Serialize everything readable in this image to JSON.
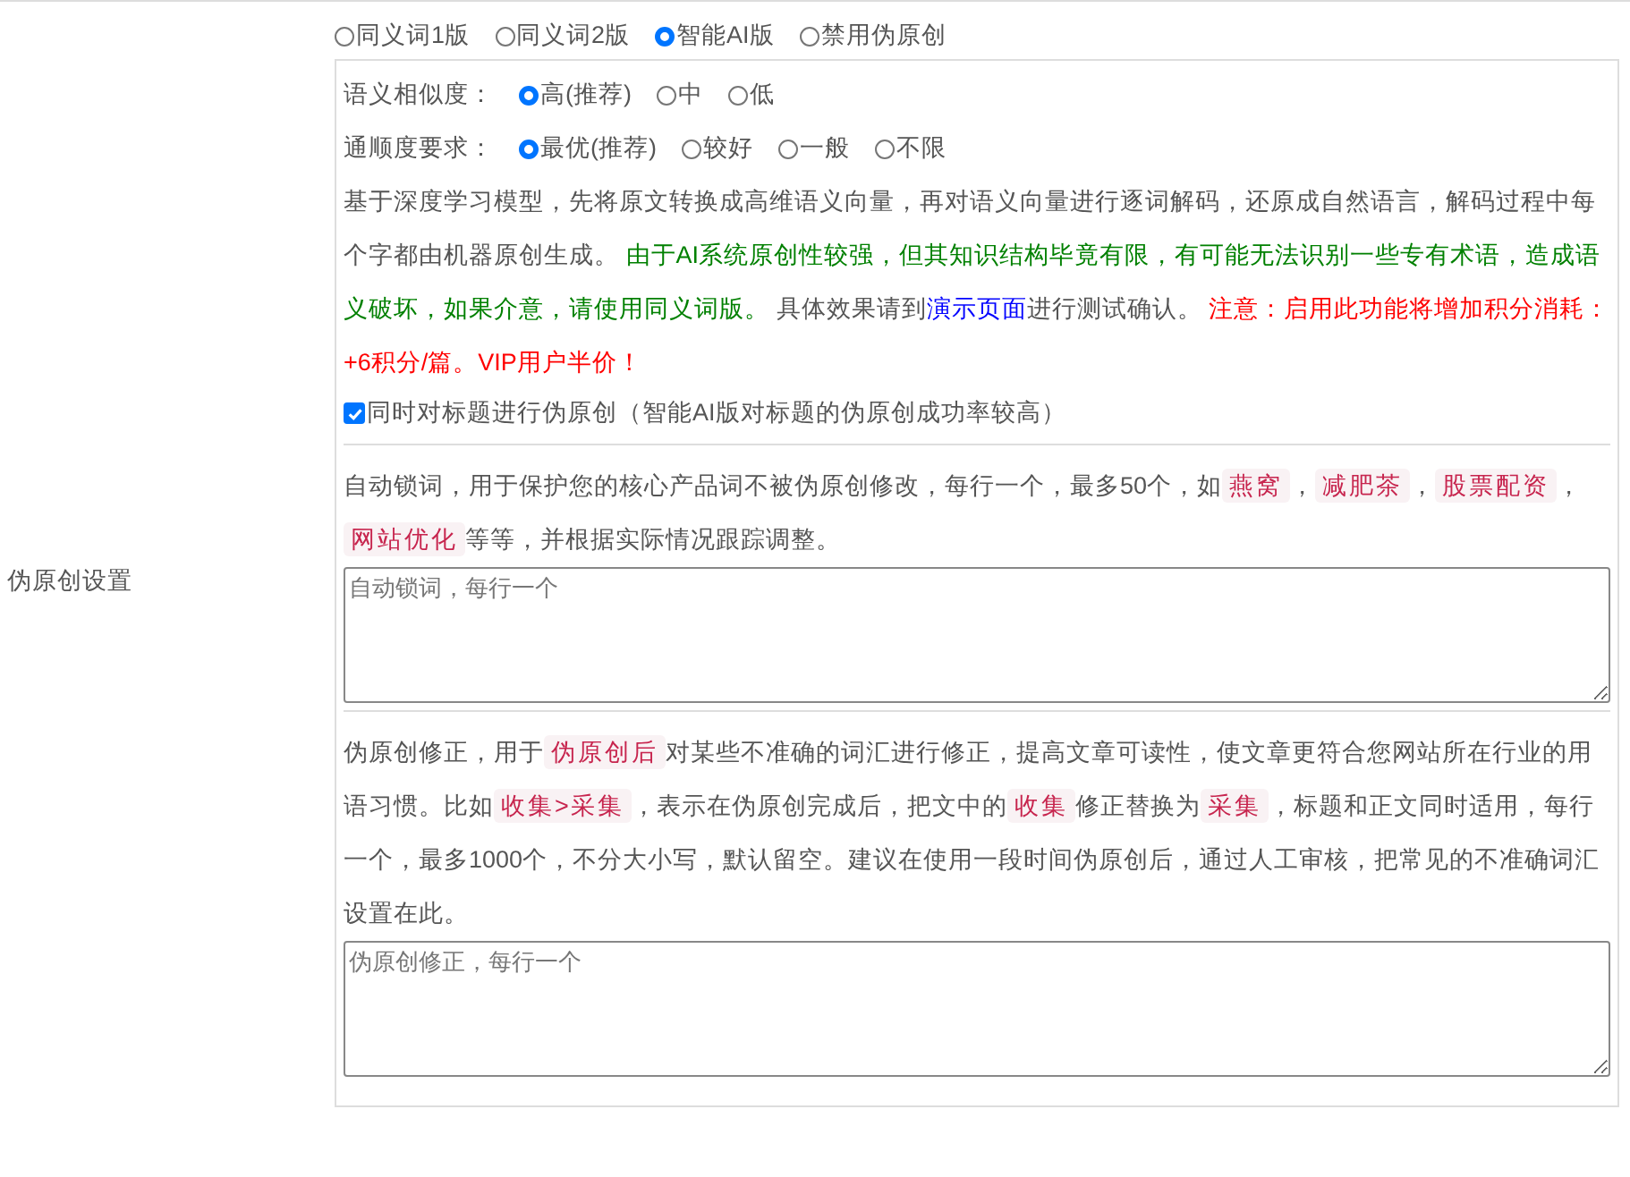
{
  "section_label": "伪原创设置",
  "mode_options": [
    {
      "label": "同义词1版",
      "selected": false
    },
    {
      "label": "同义词2版",
      "selected": false
    },
    {
      "label": "智能AI版",
      "selected": true
    },
    {
      "label": "禁用伪原创",
      "selected": false
    }
  ],
  "similarity": {
    "label": "语义相似度：",
    "options": [
      {
        "label": "高(推荐)",
        "selected": true
      },
      {
        "label": "中",
        "selected": false
      },
      {
        "label": "低",
        "selected": false
      }
    ]
  },
  "fluency": {
    "label": "通顺度要求：",
    "options": [
      {
        "label": "最优(推荐)",
        "selected": true
      },
      {
        "label": "较好",
        "selected": false
      },
      {
        "label": "一般",
        "selected": false
      },
      {
        "label": "不限",
        "selected": false
      }
    ]
  },
  "ai_description": [
    {
      "kind": "plain",
      "text": "基于深度学习模型，先将原文转换成高维语义向量，再对语义向量进行逐词解码，还原成自然语言，解码过程中每个字都由机器原创生成。 "
    },
    {
      "kind": "note",
      "text": "由于AI系统原创性较强，但其知识结构毕竟有限，有可能无法识别一些专有术语，造成语义破坏，如果介意，请使用同义词版。"
    },
    {
      "kind": "plain",
      "text": " 具体效果请到"
    },
    {
      "kind": "link",
      "text": "演示页面"
    },
    {
      "kind": "plain",
      "text": "进行测试确认。 "
    },
    {
      "kind": "warning",
      "text": "注意：启用此功能将增加积分消耗：+6积分/篇。VIP用户半价！"
    }
  ],
  "title_checkbox": {
    "label": "同时对标题进行伪原创（智能AI版对标题的伪原创成功率较高）",
    "checked": true
  },
  "lock_words": {
    "description": [
      {
        "kind": "plain",
        "text": "自动锁词，用于保护您的核心产品词不被伪原创修改，每行一个，最多50个，如"
      },
      {
        "kind": "tag",
        "text": "燕窝"
      },
      {
        "kind": "plain",
        "text": "，"
      },
      {
        "kind": "tag",
        "text": "减肥茶"
      },
      {
        "kind": "plain",
        "text": "，"
      },
      {
        "kind": "tag",
        "text": "股票配资"
      },
      {
        "kind": "plain",
        "text": "，"
      },
      {
        "kind": "tag",
        "text": "网站优化"
      },
      {
        "kind": "plain",
        "text": "等等，并根据实际情况跟踪调整。"
      }
    ],
    "placeholder": "自动锁词，每行一个"
  },
  "correction": {
    "description": [
      {
        "kind": "plain",
        "text": "伪原创修正，用于"
      },
      {
        "kind": "tag",
        "text": "伪原创后"
      },
      {
        "kind": "plain",
        "text": "对某些不准确的词汇进行修正，提高文章可读性，使文章更符合您网站所在行业的用语习惯。比如"
      },
      {
        "kind": "tag",
        "text": "收集>采集"
      },
      {
        "kind": "plain",
        "text": "，表示在伪原创完成后，把文中的"
      },
      {
        "kind": "tag",
        "text": "收集"
      },
      {
        "kind": "plain",
        "text": "修正替换为"
      },
      {
        "kind": "tag",
        "text": "采集"
      },
      {
        "kind": "plain",
        "text": "，标题和正文同时适用，每行一个，最多1000个，不分大小写，默认留空。建议在使用一段时间伪原创后，通过人工审核，把常见的不准确词汇设置在此。"
      }
    ],
    "placeholder": "伪原创修正，每行一个"
  }
}
